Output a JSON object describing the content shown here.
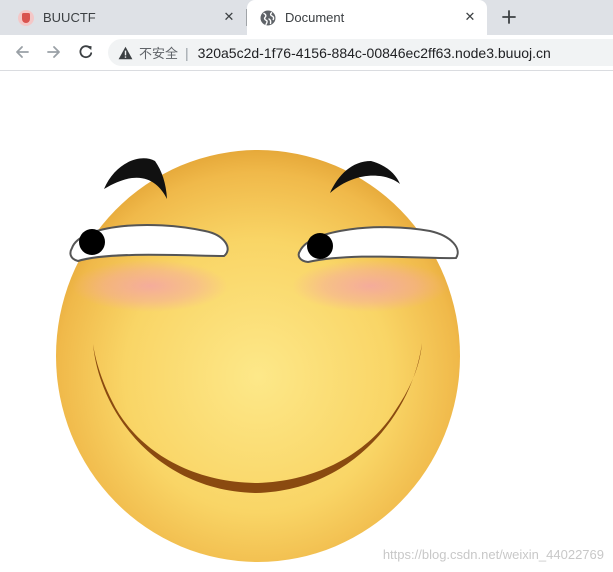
{
  "tabs": [
    {
      "title": "BUUCTF",
      "favicon": "buuctf-favicon",
      "active": false
    },
    {
      "title": "Document",
      "favicon": "globe-icon",
      "active": true
    }
  ],
  "toolbar": {
    "security_label": "不安全",
    "separator": "|",
    "url": "320a5c2d-1f76-4156-884c-00846ec2ff63.node3.buuoj.cn"
  },
  "content": {
    "image": "smiling-face-emoji",
    "watermark": "https://blog.csdn.net/weixin_44022769"
  },
  "colors": {
    "tabstrip_bg": "#dee1e6",
    "omnibox_bg": "#f1f3f4",
    "face_yellow": "#f9d566",
    "face_edge": "#e9ac3c",
    "mouth_brown": "#8a4a10",
    "blush": "#f4a5a5"
  }
}
